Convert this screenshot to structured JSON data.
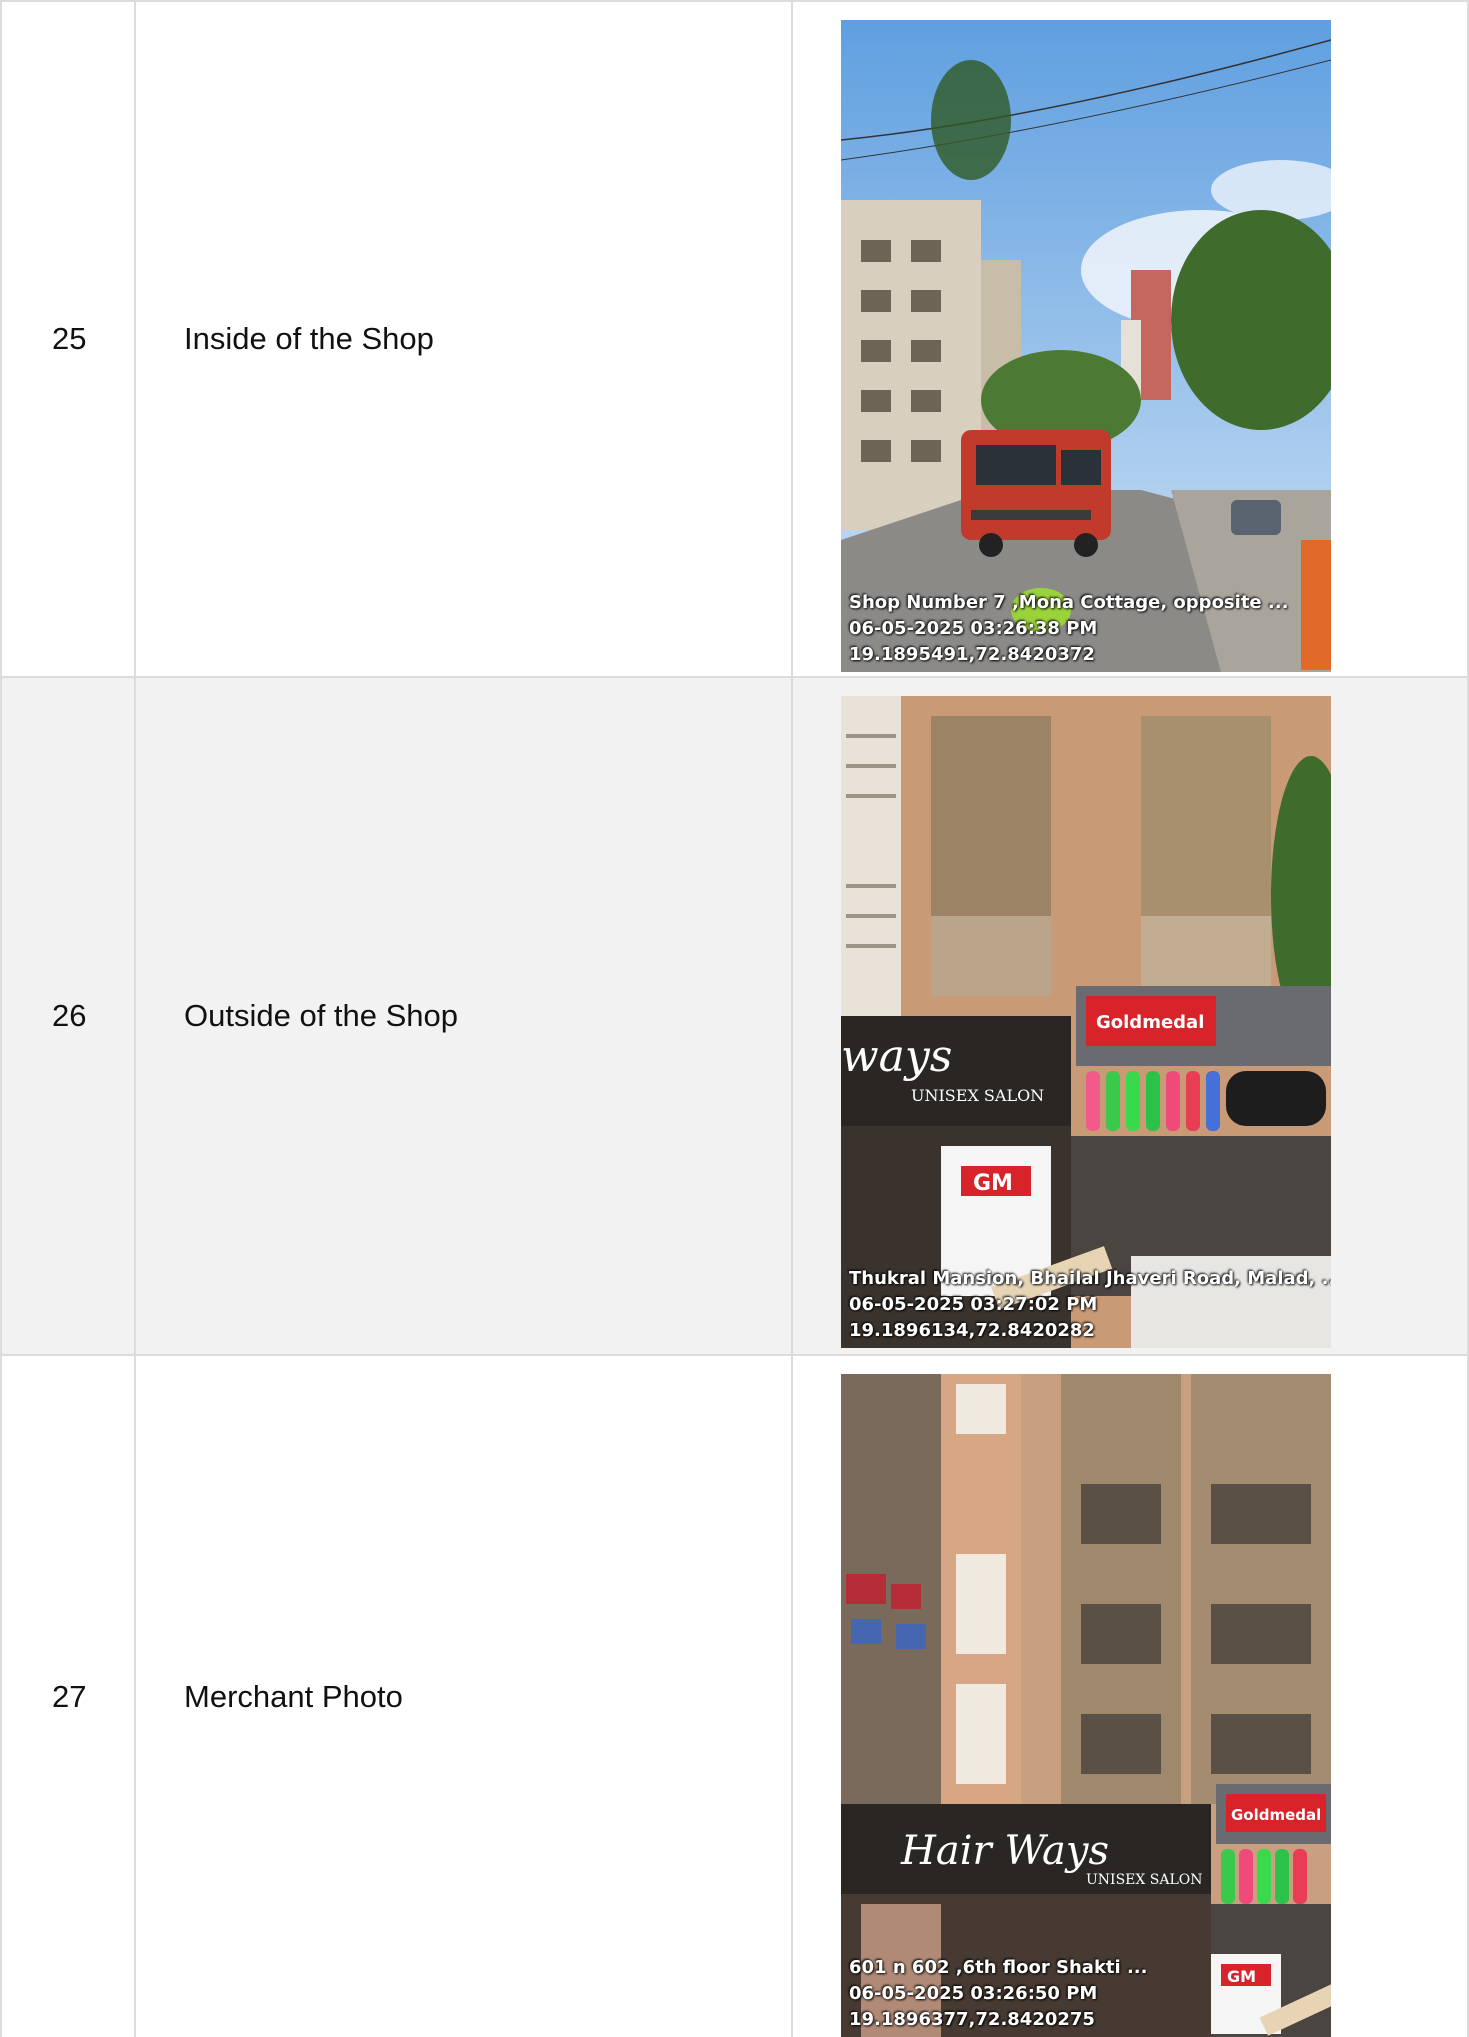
{
  "rows": [
    {
      "number": "25",
      "label": "Inside of the Shop",
      "photo": {
        "stamp_line1": "Shop Number 7 ,Mona Cottage, opposite ...",
        "stamp_line2": "06-05-2025 03:26:38 PM",
        "stamp_line3": "19.1895491,72.8420372"
      }
    },
    {
      "number": "26",
      "label": "Outside of the Shop",
      "photo": {
        "sign_brand": "ways",
        "sign_sub": "UNISEX SALON",
        "sign_goldmedal": "Goldmedal",
        "sign_gm": "GM",
        "stamp_line1": "Thukral Mansion, Bhailal Jhaveri Road, Malad, ...",
        "stamp_line2": "06-05-2025 03:27:02 PM",
        "stamp_line3": "19.1896134,72.8420282"
      }
    },
    {
      "number": "27",
      "label": "Merchant Photo",
      "photo": {
        "sign_brand": "Hair Ways",
        "sign_sub": "UNISEX SALON",
        "sign_goldmedal": "Goldmedal",
        "sign_gm": "GM",
        "stamp_line1": "601 n 602 ,6th floor Shakti ...",
        "stamp_line2": "06-05-2025 03:26:50 PM",
        "stamp_line3": "19.1896377,72.8420275"
      }
    }
  ]
}
